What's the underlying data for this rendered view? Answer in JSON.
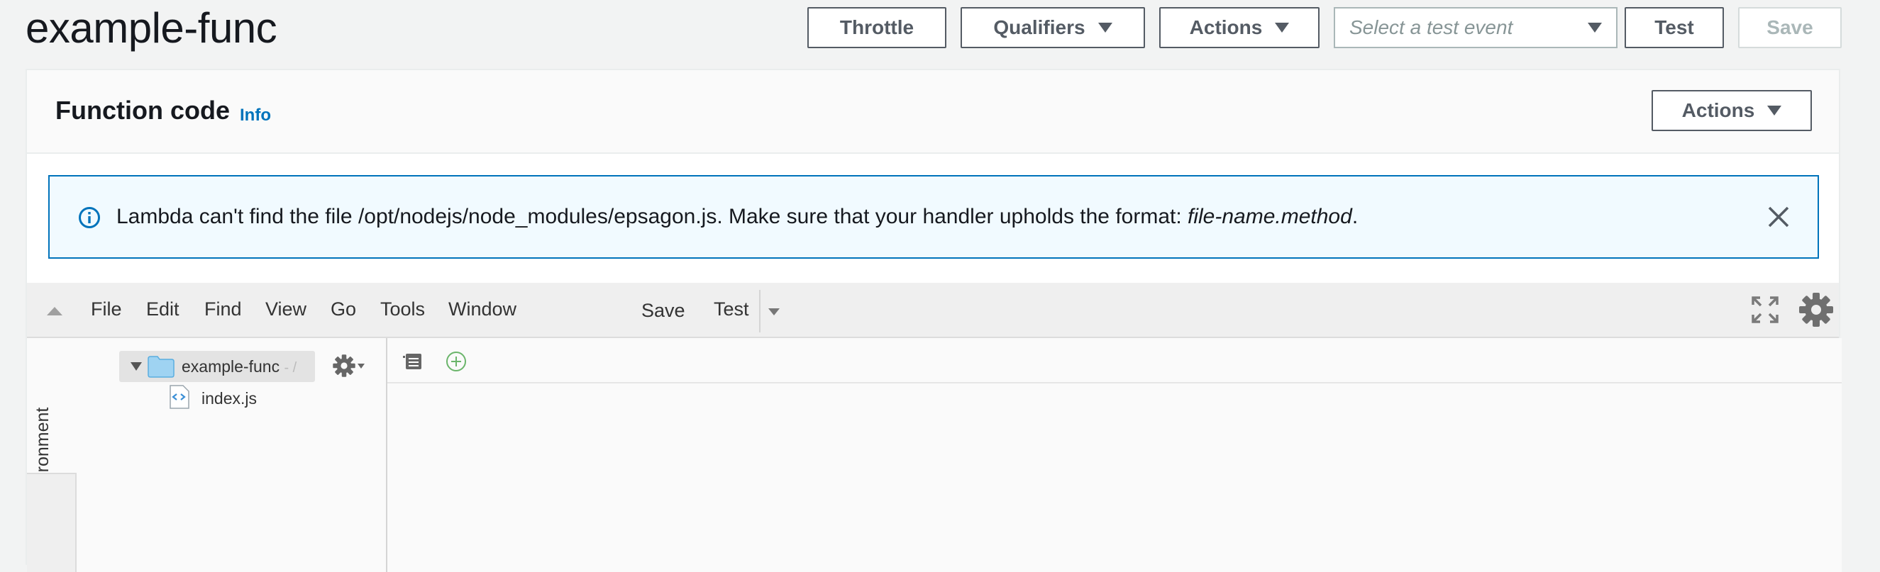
{
  "header": {
    "title": "example-func",
    "throttle_label": "Throttle",
    "qualifiers_label": "Qualifiers",
    "actions_label": "Actions",
    "test_event_placeholder": "Select a test event",
    "test_label": "Test",
    "save_label": "Save"
  },
  "function_code": {
    "title": "Function code",
    "info_label": "Info",
    "actions_label": "Actions"
  },
  "flash": {
    "message_prefix": "Lambda can't find the file /opt/nodejs/node_modules/epsagon.js. Make sure that your handler upholds the format: ",
    "message_format": "file-name.method",
    "message_suffix": "."
  },
  "ide": {
    "menu": [
      "File",
      "Edit",
      "Find",
      "View",
      "Go",
      "Tools",
      "Window"
    ],
    "save_label": "Save",
    "test_label": "Test",
    "environment_tab": "Environment",
    "tree": {
      "root_name": "example-func",
      "root_suffix": "- /",
      "files": [
        "index.js"
      ]
    }
  },
  "colors": {
    "accent": "#0073bb",
    "button_border": "#545b64",
    "disabled": "#aab7b8",
    "flash_bg": "#f1faff"
  }
}
